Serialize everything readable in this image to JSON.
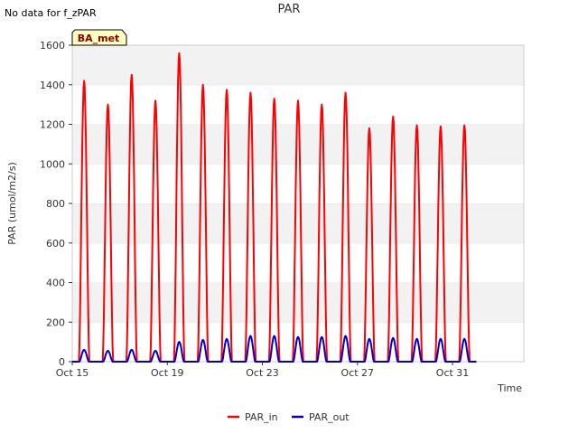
{
  "header": {
    "no_data_text": "No data for f_zPAR"
  },
  "badge": {
    "label": "BA_met"
  },
  "chart_data": {
    "type": "line",
    "title": "PAR",
    "xlabel": "Time",
    "ylabel": "PAR (umol/m2/s)",
    "ylim": [
      0,
      1600
    ],
    "xlim_days": [
      "Oct 15",
      "Nov 3"
    ],
    "yticks": [
      0,
      200,
      400,
      600,
      800,
      1000,
      1200,
      1400,
      1600
    ],
    "xticks": [
      "Oct 15",
      "Oct 19",
      "Oct 23",
      "Oct 27",
      "Oct 31"
    ],
    "grid": "horizontal bands",
    "legend_position": "bottom-center",
    "day_starts": [
      "Oct 15",
      "Oct 16",
      "Oct 17",
      "Oct 18",
      "Oct 19",
      "Oct 20",
      "Oct 21",
      "Oct 22",
      "Oct 23",
      "Oct 24",
      "Oct 25",
      "Oct 26",
      "Oct 27",
      "Oct 28",
      "Oct 29",
      "Oct 30",
      "Oct 31",
      "Nov 1"
    ],
    "series": [
      {
        "name": "PAR_in",
        "color": "#ff0000",
        "daily_peak": [
          1420,
          1300,
          1450,
          1320,
          1560,
          1400,
          1375,
          1360,
          1330,
          1320,
          1300,
          1360,
          1180,
          1240,
          1195,
          1190,
          1195
        ]
      },
      {
        "name": "PAR_out",
        "color": "#0000cc",
        "daily_peak": [
          60,
          55,
          60,
          55,
          100,
          110,
          115,
          130,
          130,
          125,
          125,
          130,
          115,
          120,
          115,
          115,
          115
        ]
      }
    ]
  }
}
